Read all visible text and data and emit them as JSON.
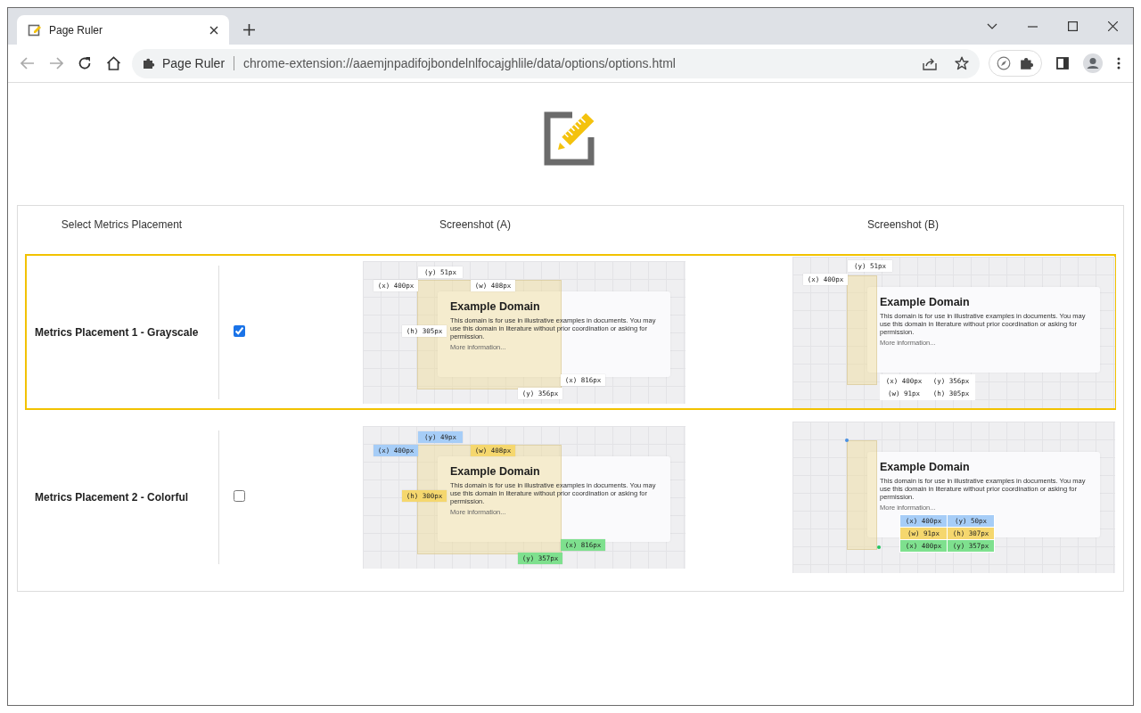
{
  "window": {
    "tab": {
      "title": "Page Ruler",
      "selected": true
    },
    "address_bar": {
      "site_label": "Page Ruler",
      "url": "chrome-extension://aaemjnpadifojbondelnlfocajghlile/data/options/options.html"
    }
  },
  "table": {
    "columns": [
      "Select Metrics Placement",
      "Screenshot (A)",
      "Screenshot (B)"
    ],
    "rows": [
      {
        "label": "Metrics Placement 1 - Grayscale",
        "selected": true,
        "checked": true,
        "screenshot_a": {
          "kind": "wide",
          "page": {
            "title": "Example Domain",
            "text": "This domain is for use in illustrative examples in documents. You may use this domain in literature without prior coordination or asking for permission.",
            "link": "More information..."
          },
          "tags": [
            {
              "kind": "top",
              "label": "(y) 51px",
              "color": "#ffffff"
            },
            {
              "kind": "left",
              "label": "(x) 400px",
              "color": "#ffffff"
            },
            {
              "kind": "width",
              "label": "(w) 408px",
              "color": "#ffffff"
            },
            {
              "kind": "height",
              "label": "(h) 305px",
              "color": "#ffffff"
            },
            {
              "kind": "right",
              "label": "(x) 816px",
              "color": "#ffffff"
            },
            {
              "kind": "bottom",
              "label": "(y) 356px",
              "color": "#ffffff"
            }
          ]
        },
        "screenshot_b": {
          "kind": "narrow",
          "page": {
            "title": "Example Domain",
            "text": "This domain is for use in illustrative examples in documents. You may use this domain in literature without prior coordination or asking for permission.",
            "link": "More information..."
          },
          "tags": [
            {
              "kind": "top",
              "label": "(y) 51px",
              "color": "#ffffff"
            },
            {
              "kind": "left",
              "label": "(x) 400px",
              "color": "#ffffff"
            }
          ],
          "grid": [
            [
              {
                "label": "(x) 400px",
                "color": "#ffffff"
              },
              {
                "label": "(y) 356px",
                "color": "#ffffff"
              }
            ],
            [
              {
                "label": "(w) 91px",
                "color": "#ffffff"
              },
              {
                "label": "(h) 305px",
                "color": "#ffffff"
              }
            ]
          ]
        }
      },
      {
        "label": "Metrics Placement 2 - Colorful",
        "selected": false,
        "checked": false,
        "screenshot_a": {
          "kind": "wide",
          "page": {
            "title": "Example Domain",
            "text": "This domain is for use in illustrative examples in documents. You may use this domain in literature without prior coordination or asking for permission.",
            "link": "More information..."
          },
          "tags": [
            {
              "kind": "top",
              "label": "(y) 49px",
              "color": "#a6cdf7"
            },
            {
              "kind": "left",
              "label": "(x) 400px",
              "color": "#a6cdf7"
            },
            {
              "kind": "width",
              "label": "(w) 408px",
              "color": "#f5d76e"
            },
            {
              "kind": "height",
              "label": "(h) 300px",
              "color": "#f5d76e"
            },
            {
              "kind": "right",
              "label": "(x) 816px",
              "color": "#7ee08e"
            },
            {
              "kind": "bottom",
              "label": "(y) 357px",
              "color": "#7ee08e"
            }
          ]
        },
        "screenshot_b": {
          "kind": "narrow",
          "page": {
            "title": "Example Domain",
            "text": "This domain is for use in illustrative examples in documents. You may use this domain in literature without prior coordination or asking for permission.",
            "link": "More information..."
          },
          "markers": [
            {
              "kind": "start",
              "color": "#4a90e2"
            },
            {
              "kind": "end",
              "color": "#22c55e"
            }
          ],
          "grid": [
            [
              {
                "label": "(x) 400px",
                "color": "#a6cdf7"
              },
              {
                "label": "(y) 50px",
                "color": "#a6cdf7"
              }
            ],
            [
              {
                "label": "(w) 91px",
                "color": "#f5d76e"
              },
              {
                "label": "(h) 307px",
                "color": "#f5d76e"
              }
            ],
            [
              {
                "label": "(x) 400px",
                "color": "#7ee08e"
              },
              {
                "label": "(y) 357px",
                "color": "#7ee08e"
              }
            ]
          ]
        }
      }
    ]
  }
}
